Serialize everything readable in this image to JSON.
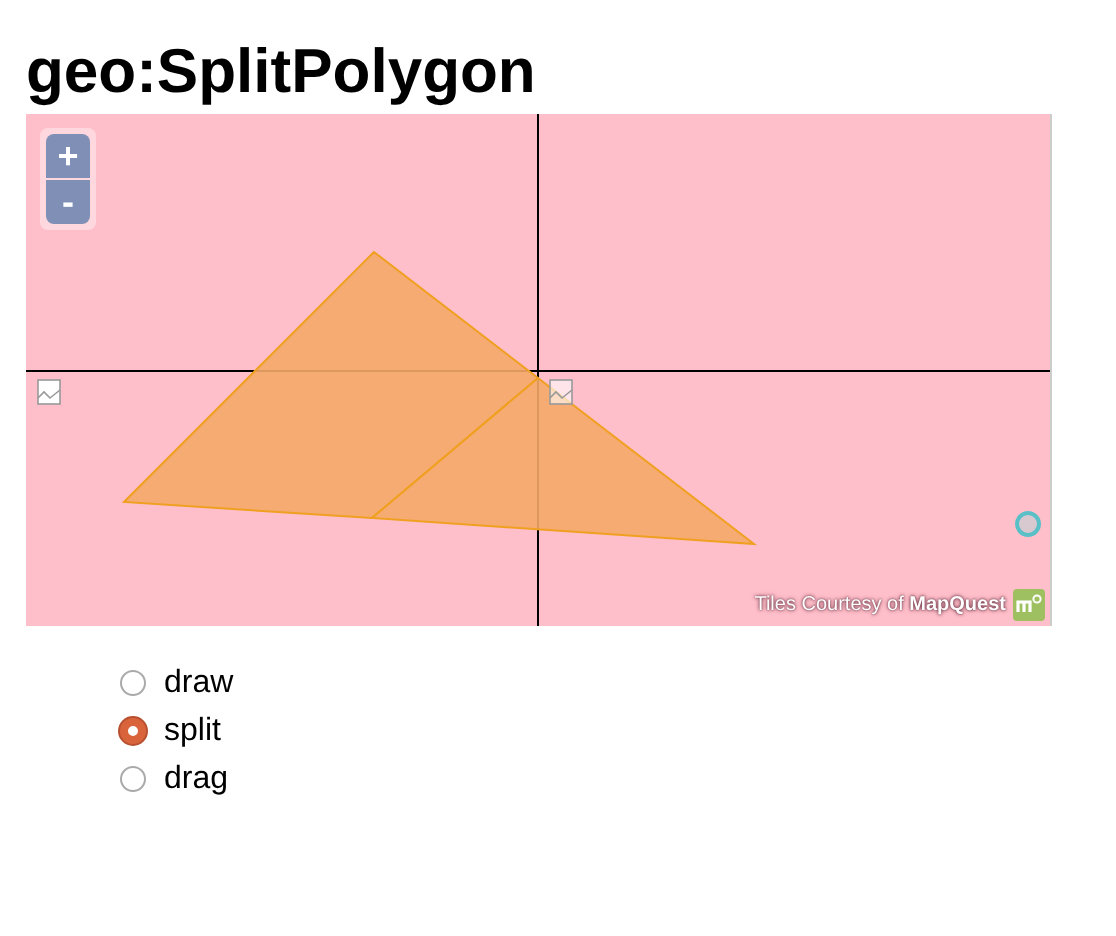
{
  "title": "geo:SplitPolygon",
  "map": {
    "zoom_in": "+",
    "zoom_out": "-",
    "attribution": "Tiles Courtesy of **MapQuest**"
  },
  "modes": [
    {
      "label": "draw",
      "selected": false
    },
    {
      "label": "split",
      "selected": true
    },
    {
      "label": "drag",
      "selected": false
    }
  ]
}
